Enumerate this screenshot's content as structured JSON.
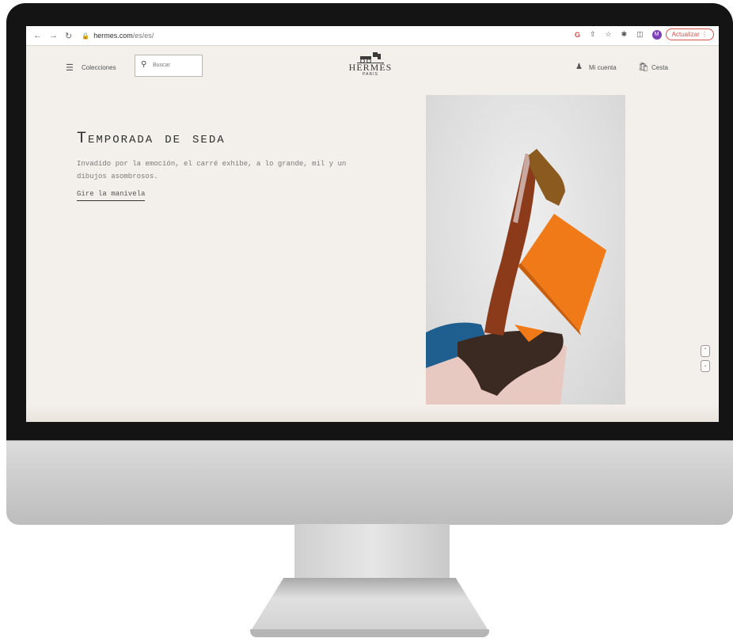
{
  "browser": {
    "url_host": "hermes.com",
    "url_path": "/es/es/",
    "update_label": "Actualizar",
    "profile_initial": "M"
  },
  "header": {
    "menu_label": "Colecciones",
    "search_placeholder": "Buscar",
    "logo_name": "HERMÈS",
    "logo_city": "PARIS",
    "account_label": "Mi cuenta",
    "cart_label": "Cesta"
  },
  "hero": {
    "title": "Temporada de seda",
    "description": "Invadido por la emoción, el carré exhibe, a lo grande, mil y un dibujos asombrosos.",
    "link_label": "Gire la manivela"
  },
  "icons": {
    "back": "back-arrow-icon",
    "forward": "forward-arrow-icon",
    "reload": "reload-icon",
    "lock": "lock-icon",
    "menu": "hamburger-menu-icon",
    "search": "search-icon",
    "account": "user-icon",
    "cart": "shopping-bag-icon"
  },
  "colors": {
    "page_background": "#f3efeb",
    "accent_orange": "#f07a17",
    "update_button": "#d8514a"
  }
}
